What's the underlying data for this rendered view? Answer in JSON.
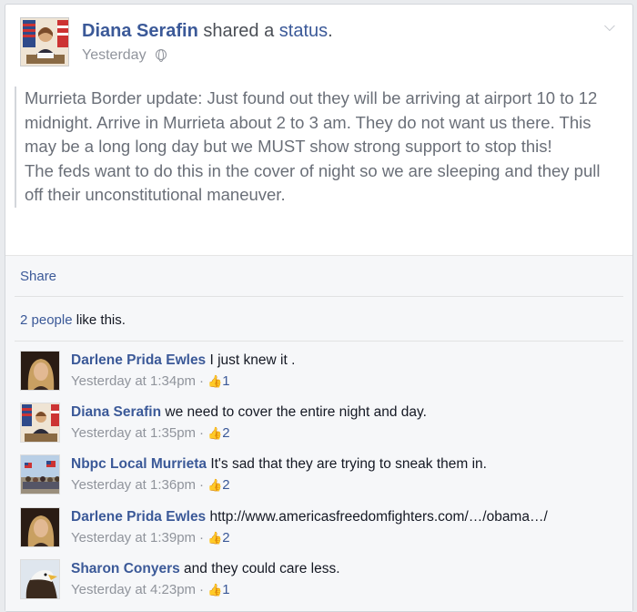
{
  "post": {
    "author": "Diana Serafin",
    "action_prefix": "shared a",
    "action_link": "status",
    "action_suffix": ".",
    "timestamp": "Yesterday",
    "audience_icon": "globe-icon",
    "menu_icon": "chevron-down-icon",
    "body_paragraphs": [
      "Murrieta Border update: Just found out they will be arriving at airport 10 to 12 midnight. Arrive in Murrieta about 2 to 3 am. They do not want us there. This may be a long long day but we MUST show strong support to stop this!",
      "The feds want to do this in the cover of night so we are sleeping and they pull off their unconstitutional maneuver."
    ]
  },
  "actions": {
    "share_label": "Share"
  },
  "likes": {
    "people": "2 people",
    "suffix": " like this."
  },
  "comments": [
    {
      "author": "Darlene Prida Ewles",
      "text": "I just knew it .",
      "time": "Yesterday at 1:34pm",
      "likes": "1",
      "avatar": "woman-blonde"
    },
    {
      "author": "Diana Serafin",
      "text": "we need to cover the entire night and day.",
      "time": "Yesterday at 1:35pm",
      "likes": "2",
      "avatar": "flags-desk"
    },
    {
      "author": "Nbpc Local Murrieta",
      "text": "It's sad that they are trying to sneak them in.",
      "time": "Yesterday at 1:36pm",
      "likes": "2",
      "avatar": "crowd-flags"
    },
    {
      "author": "Darlene Prida Ewles",
      "text": "http://www.americasfreedomfighters.com/…/obama…/",
      "time": "Yesterday at 1:39pm",
      "likes": "2",
      "avatar": "woman-blonde"
    },
    {
      "author": "Sharon Conyers",
      "text": "and they could care less.",
      "time": "Yesterday at 4:23pm",
      "likes": "1",
      "avatar": "eagle"
    }
  ],
  "colors": {
    "link": "#3b5998",
    "meta": "#90949c",
    "body": "#6a6f78"
  }
}
